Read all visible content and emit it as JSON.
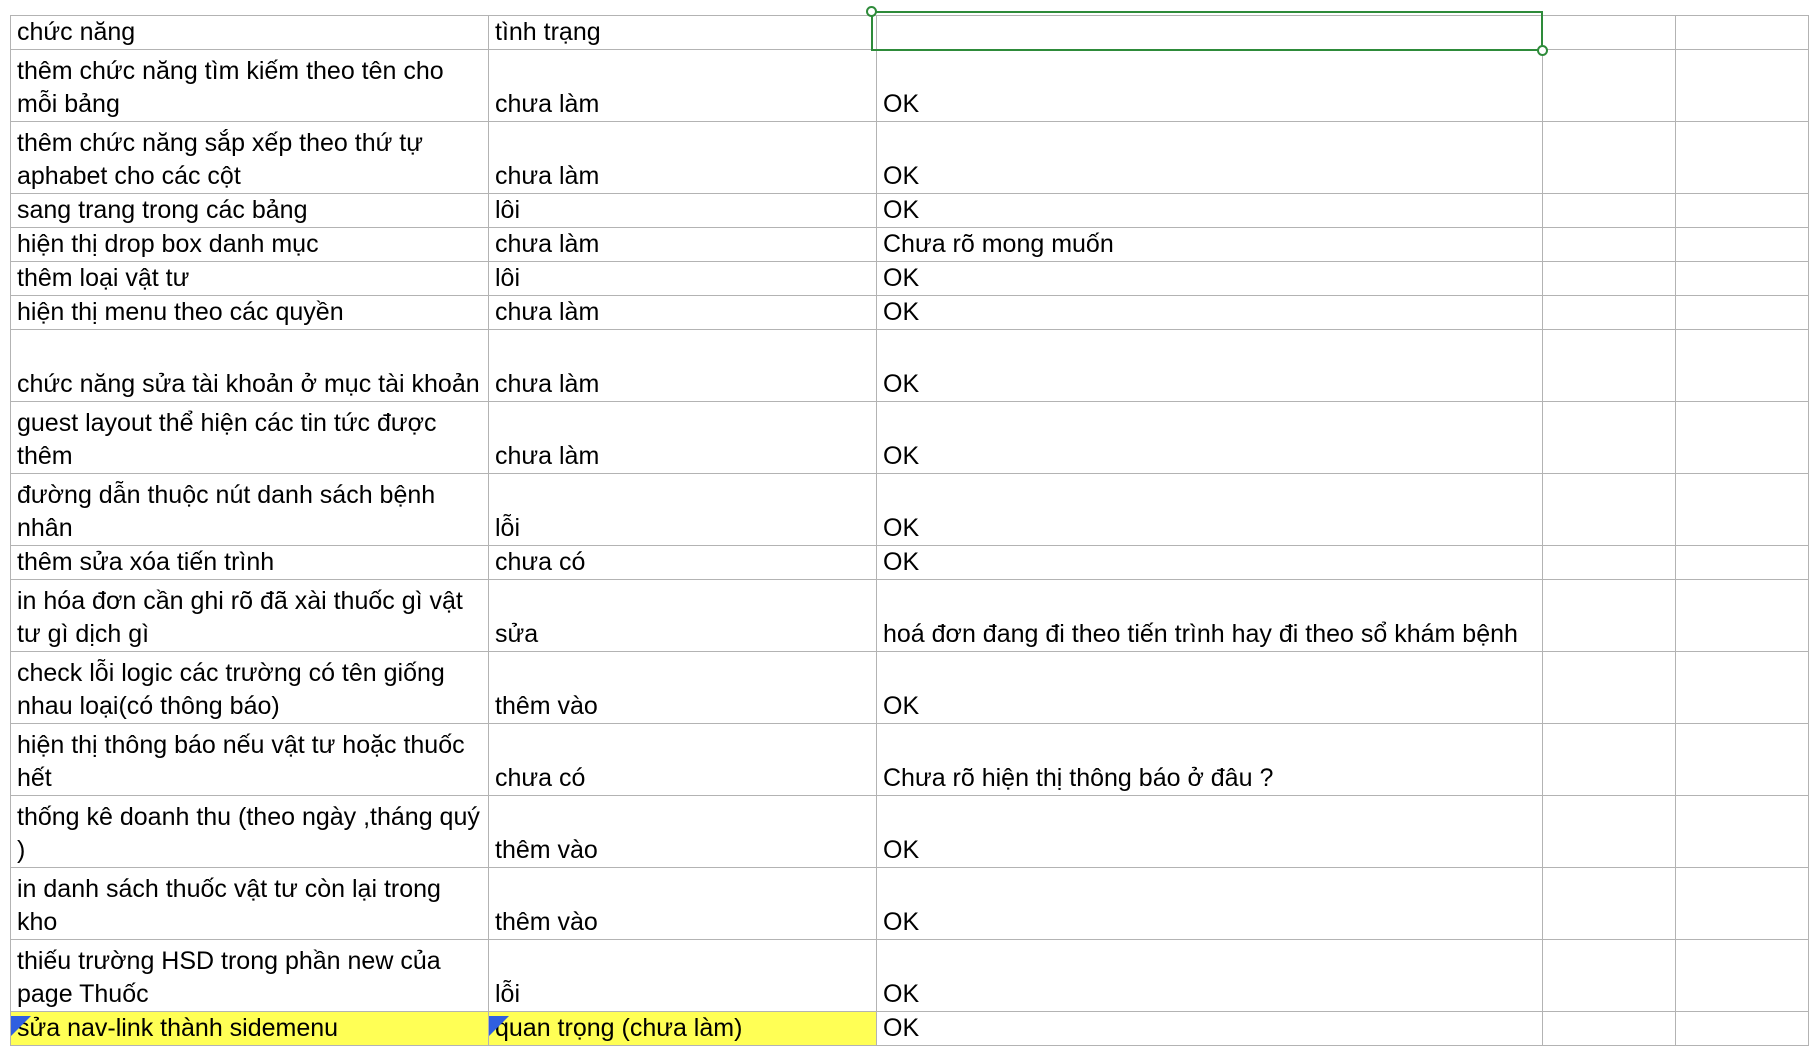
{
  "sheet": {
    "header": {
      "feature": "chức năng",
      "status": "tình trạng",
      "note": ""
    },
    "rows": [
      {
        "feature": "thêm chức năng tìm kiếm theo tên cho mỗi bảng",
        "status": "chưa làm",
        "note": "OK"
      },
      {
        "feature": "thêm chức năng sắp xếp theo thứ tự aphabet cho các cột",
        "status": "chưa làm",
        "note": "OK"
      },
      {
        "feature": "sang trang trong các bảng",
        "status": "lôi",
        "note": "OK"
      },
      {
        "feature": "hiện thị drop box danh mục",
        "status": "chưa làm",
        "note": "Chưa rõ mong muốn"
      },
      {
        "feature": "thêm loại vật tư",
        "status": "lôi",
        "note": "OK"
      },
      {
        "feature": "hiện thị menu theo các quyền",
        "status": "chưa làm",
        "note": "OK"
      },
      {
        "feature": "chức năng sửa tài khoản ở mục tài khoản",
        "status": "chưa làm",
        "note": "OK"
      },
      {
        "feature": "guest layout thể hiện các tin tức được thêm",
        "status": "chưa làm",
        "note": "OK"
      },
      {
        "feature": "đường dẫn thuộc nút danh sách bệnh nhân",
        "status": "lỗi",
        "note": "OK"
      },
      {
        "feature": "thêm sửa xóa tiến trình",
        "status": "chưa có",
        "note": "OK"
      },
      {
        "feature": "in hóa đơn cần ghi rõ đã xài thuốc gì vật tư gì dịch gì",
        "status": "sửa",
        "note": "hoá đơn đang đi theo tiến trình hay đi theo sổ khám bệnh"
      },
      {
        "feature": "check lỗi logic các trường có tên  giống nhau loại(có thông báo)",
        "status": "thêm vào",
        "note": "OK"
      },
      {
        "feature": "hiện thị thông báo nếu vật tư hoặc thuốc hết",
        "status": "chưa có",
        "note": "Chưa rõ hiện thị thông báo ở đâu ?"
      },
      {
        "feature": "thống kê doanh thu (theo ngày ,tháng quý )",
        "status": "thêm vào",
        "note": "OK"
      },
      {
        "feature": "in danh sách thuốc vật tư còn lại trong kho",
        "status": "thêm vào",
        "note": "OK"
      },
      {
        "feature": "thiếu trường HSD trong phần new của page Thuốc",
        "status": "lỗi",
        "note": "OK"
      },
      {
        "feature": "sửa nav-link thành sidemenu",
        "status": "quan trọng (chưa làm)",
        "note": "OK"
      }
    ]
  },
  "colors": {
    "highlight": "#ffff55",
    "selection": "#2e8b3a",
    "note_flag": "#2f5fe0",
    "gridline": "#b3b3b3"
  },
  "icons": [
    "comment-indicator-icon"
  ]
}
